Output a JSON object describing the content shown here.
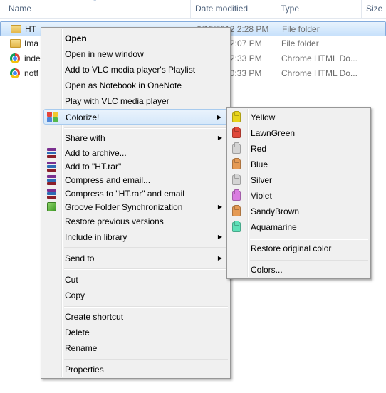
{
  "header": {
    "columns": [
      "Name",
      "Date modified",
      "Type",
      "Size"
    ],
    "sort_arrow": "^"
  },
  "files": [
    {
      "name": "HT",
      "date": "6/16/2012 2:28 PM",
      "type": "File folder",
      "icon": "folder-icon",
      "selected": true
    },
    {
      "name": "Ima",
      "date": "2:07 PM",
      "type": "File folder",
      "icon": "folder-icon",
      "selected": false
    },
    {
      "name": "inde",
      "date": "2:33 PM",
      "type": "Chrome HTML Do...",
      "icon": "chrome-icon",
      "selected": false
    },
    {
      "name": "notf",
      "date": "10:33 PM",
      "type": "Chrome HTML Do...",
      "icon": "chrome-icon",
      "selected": false
    }
  ],
  "context_menu": {
    "items": [
      {
        "label": "Open",
        "bold": true
      },
      {
        "label": "Open in new window"
      },
      {
        "label": "Add to VLC media player's Playlist"
      },
      {
        "label": "Open as Notebook in OneNote"
      },
      {
        "label": "Play with VLC media player"
      },
      {
        "label": "Colorize!",
        "icon": "colorize-icon",
        "submenu": true,
        "highlighted": true
      },
      {
        "label": "Share with",
        "submenu": true
      },
      {
        "label": "Add to archive...",
        "icon": "winrar-icon"
      },
      {
        "label": "Add to \"HT.rar\"",
        "icon": "winrar-icon"
      },
      {
        "label": "Compress and email...",
        "icon": "winrar-icon"
      },
      {
        "label": "Compress to \"HT.rar\" and email",
        "icon": "winrar-icon"
      },
      {
        "label": "Groove Folder Synchronization",
        "icon": "groove-icon",
        "submenu": true
      },
      {
        "label": "Restore previous versions"
      },
      {
        "label": "Include in library",
        "submenu": true
      },
      {
        "label": "Send to",
        "submenu": true
      },
      {
        "label": "Cut"
      },
      {
        "label": "Copy"
      },
      {
        "label": "Create shortcut"
      },
      {
        "label": "Delete"
      },
      {
        "label": "Rename"
      },
      {
        "label": "Properties"
      }
    ],
    "submenu_arrow": "▶"
  },
  "colorize_submenu": {
    "colors": [
      {
        "label": "Yellow",
        "color": "#e8d41a"
      },
      {
        "label": "LawnGreen",
        "color": "#6cd41e"
      },
      {
        "label": "Red",
        "color": "#e0483a"
      },
      {
        "label": "Blue",
        "color": "#4f7fd1"
      },
      {
        "label": "Silver",
        "color": "#d4d4d4"
      },
      {
        "label": "Violet",
        "color": "#d97de0"
      },
      {
        "label": "SandyBrown",
        "color": "#e59a54"
      },
      {
        "label": "Aquamarine",
        "color": "#5fe0b8"
      }
    ],
    "restore_label": "Restore original color",
    "colors_label": "Colors..."
  }
}
